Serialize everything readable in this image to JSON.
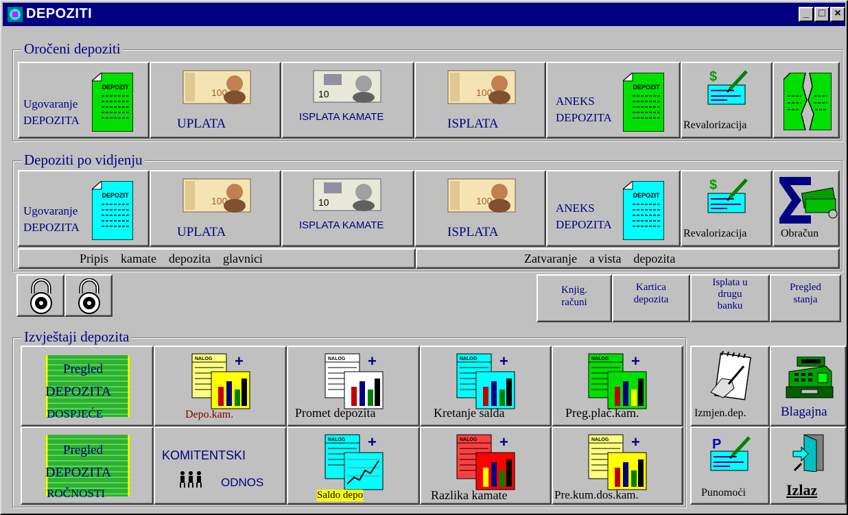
{
  "window": {
    "title": "DEPOZITI",
    "controls": {
      "minimize": "_",
      "maximize": "□",
      "close": "×"
    }
  },
  "oroceni": {
    "title": "Oročeni depoziti",
    "ugovaranje": {
      "line1": "Ugovaranje",
      "line2": "DEPOZITA"
    },
    "uplata": "UPLATA",
    "isplata_kamate": "ISPLATA KAMATE",
    "isplata": "ISPLATA",
    "aneks": {
      "line1": "ANEKS",
      "line2": "DEPOZITA"
    },
    "revalorizacija": "Revalorizacija"
  },
  "vidjenje": {
    "title": "Depoziti po vidjenju",
    "ugovaranje": {
      "line1": "Ugovaranje",
      "line2": "DEPOZITA"
    },
    "uplata": "UPLATA",
    "isplata_kamate": "ISPLATA KAMATE",
    "isplata": "ISPLATA",
    "aneks": {
      "line1": "ANEKS",
      "line2": "DEPOZITA"
    },
    "revalorizacija": "Revalorizacija",
    "obracun": "Obračun",
    "pripis": "Pripis    kamate    depozita    glavnici",
    "zatvaranje": "Zatvaranje    a vista    depozita"
  },
  "middle": {
    "knjig": {
      "line1": "Knjig.",
      "line2": "računi"
    },
    "kartica": {
      "line1": "Kartica",
      "line2": "depozita"
    },
    "isplata_banku": {
      "line1": "Isplata u",
      "line2": "drugu",
      "line3": "banku"
    },
    "pregled_stanja": {
      "line1": "Pregled",
      "line2": "stanja"
    }
  },
  "izvjestaji": {
    "title": "Izvještaji depozita",
    "pregled_dospjece": {
      "line1": "Pregled",
      "line2": "DEPOZITA",
      "line3": "DOSPJEĆE"
    },
    "depo_kam": "Depo.kam.",
    "promet": "Promet depozita",
    "kretanje": "Kretanje salda",
    "preg_plac": "Preg.plać.kam.",
    "pregled_rocnosti": {
      "line1": "Pregled",
      "line2": "DEPOZITA",
      "line3": "ROČNOSTI"
    },
    "komitentski": {
      "line1": "KOMITENTSKI",
      "line2": "ODNOS"
    },
    "saldo": "Saldo depo",
    "razlika": "Razlika kamate",
    "pre_kum": "Pre.kum.dos.kam."
  },
  "right": {
    "izmjen": "Izmjen.dep.",
    "blagajna": "Blagajna",
    "punomoci": "Punomoći",
    "izlaz": "Izlaz"
  },
  "icon_text": {
    "depozit": "DEPOZIT",
    "n100": "100",
    "n10": "10",
    "nalog": "NALOG"
  },
  "colors": {
    "title_bg": "#000080",
    "label": "#000080",
    "face": "#c0c0c0",
    "doc_green": "#00e000",
    "doc_cyan": "#00ffff"
  }
}
